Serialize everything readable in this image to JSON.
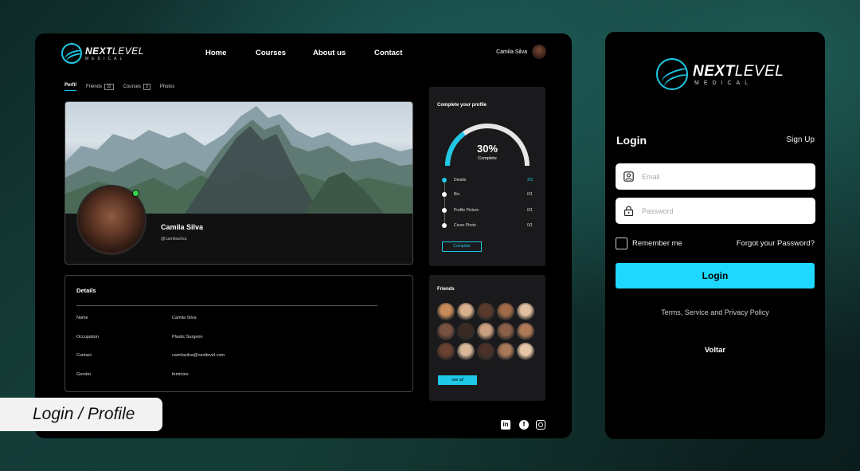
{
  "brand": {
    "name_bold": "NEXT",
    "name_light": "LEVEL",
    "tagline": "MEDICAL"
  },
  "colors": {
    "accent": "#1ec8e6",
    "login_button": "#1ed8ff",
    "panel_bg": "#000000",
    "card_bg": "#1a1a1c",
    "online": "#32d64a"
  },
  "nav": {
    "home": "Home",
    "courses": "Courses",
    "about": "About us",
    "contact": "Contact"
  },
  "header_user": {
    "name": "Camila Silva"
  },
  "tabs": [
    {
      "label": "Perfil",
      "count": ""
    },
    {
      "label": "Friends",
      "count": "32"
    },
    {
      "label": "Courses",
      "count": "3"
    },
    {
      "label": "Photos",
      "count": ""
    }
  ],
  "profile": {
    "name": "Camila Silva",
    "handle": "@camilasilva"
  },
  "details": {
    "title": "Details",
    "rows": [
      {
        "key": "Name",
        "value": "Camila Silva"
      },
      {
        "key": "Occupation",
        "value": "Plastic Surgeon"
      },
      {
        "key": "Contact",
        "value": "camilasilva@nextlevel.com"
      },
      {
        "key": "Gender",
        "value": "feminine"
      }
    ]
  },
  "completion": {
    "title": "Complete your profile",
    "percent_label": "30%",
    "percent": 30,
    "status": "Complete",
    "steps": [
      {
        "label": "Details",
        "value": "3/3",
        "done": true
      },
      {
        "label": "Bio",
        "value": "0/1",
        "done": false
      },
      {
        "label": "Profile Picture",
        "value": "0/1",
        "done": false
      },
      {
        "label": "Cover Photo",
        "value": "0/1",
        "done": false
      }
    ],
    "button": "Complete"
  },
  "friends": {
    "title": "Friends",
    "count_shown": 15,
    "button": "see all"
  },
  "social": {
    "linkedin_icon": "linkedin-icon",
    "facebook_icon": "facebook-icon",
    "instagram_icon": "instagram-icon"
  },
  "badge": "Login / Profile",
  "login": {
    "title": "Login",
    "signup": "Sign Up",
    "email_placeholder": "Email",
    "password_placeholder": "Password",
    "remember": "Remember me",
    "forgot": "Forgot your Password?",
    "button": "Login",
    "terms": "Terms, Service and Privacy Policy",
    "back": "Voltar"
  }
}
